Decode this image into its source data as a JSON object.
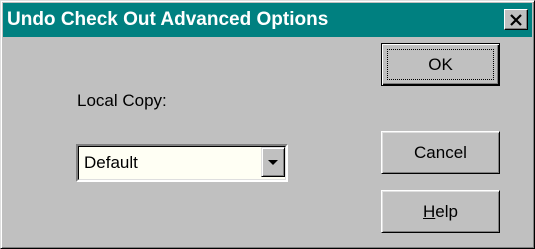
{
  "dialog": {
    "title": "Undo Check Out Advanced Options",
    "close_glyph": "×",
    "colors": {
      "titlebar": "#008080",
      "face": "#c0c0c0",
      "field": "#fffff4"
    }
  },
  "form": {
    "local_copy_label": "Local Copy:",
    "local_copy_value": "Default"
  },
  "buttons": {
    "ok_label": "OK",
    "cancel_label": "Cancel",
    "help_mnemonic": "H",
    "help_rest": "elp"
  }
}
